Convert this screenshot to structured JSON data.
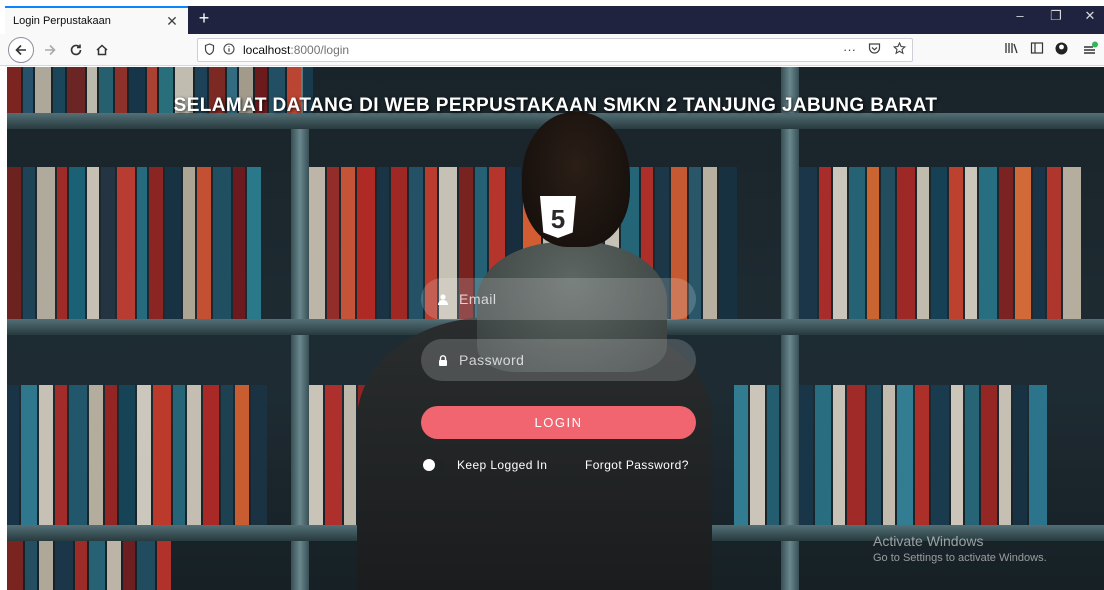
{
  "browser": {
    "tab_title": "Login Perpustakaan",
    "tab_close": "✕",
    "new_tab": "+",
    "url_host": "localhost",
    "url_rest": ":8000/login",
    "icons": [
      "back-arrow-icon",
      "forward-arrow-icon",
      "reload-icon",
      "home-icon",
      "shield-icon",
      "info-icon",
      "more-icon",
      "pocket-icon",
      "bookmark-star-icon",
      "library-icon",
      "sidebar-icon",
      "account-icon",
      "menu-icon"
    ],
    "window_controls": [
      "–",
      "❐",
      "✕"
    ]
  },
  "page": {
    "title": "SELAMAT DATANG DI WEB PERPUSTAKAAN SMKN 2 TANJUNG JABUNG BARAT",
    "logo_mark": "5",
    "email_placeholder": "Email",
    "password_placeholder": "Password",
    "login_label": "LOGIN",
    "keep_logged_in": "Keep Logged In",
    "keep_logged_in_checked": false,
    "forgot_password": "Forgot Password?",
    "accent_color": "#f0656f"
  },
  "watermark": {
    "line1": "Activate Windows",
    "line2": "Go to Settings to activate Windows."
  }
}
